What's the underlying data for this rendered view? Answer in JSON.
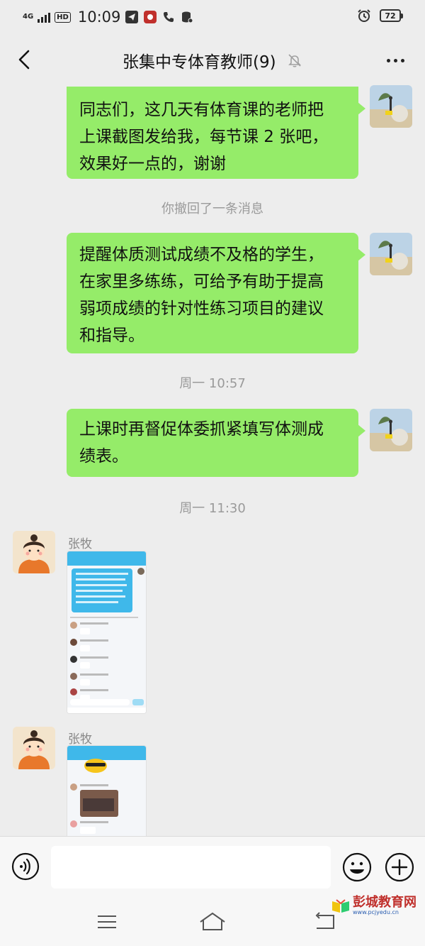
{
  "status_bar": {
    "network": "4G",
    "hd_badge": "HD",
    "time": "10:09",
    "battery": "72"
  },
  "header": {
    "title": "张集中专体育教师(9)"
  },
  "messages": {
    "m1": {
      "line1": "同志们，这几天有体育课的老师把",
      "line2": "上课截图发给我，每节课 2 张吧，",
      "line3": "效果好一点的，谢谢"
    },
    "recall_notice": "你撤回了一条消息",
    "m2": {
      "line1": "提醒体质测试成绩不及格的学生，",
      "line2": "在家里多练练，可给予有助于提高",
      "line3": "弱项成绩的针对性练习项目的建议",
      "line4": "和指导。"
    },
    "time1": "周一 10:57",
    "m3": {
      "line1": "上课时再督促体委抓紧填写体测成",
      "line2": "绩表。"
    },
    "time2": "周一 11:30",
    "sender1": "张牧",
    "sender2": "张牧"
  },
  "input": {
    "placeholder": ""
  },
  "watermark": {
    "name": "彭城教育网",
    "url": "www.pcjyedu.cn"
  },
  "colors": {
    "bubble_out": "#95ec69",
    "background": "#ededed"
  }
}
